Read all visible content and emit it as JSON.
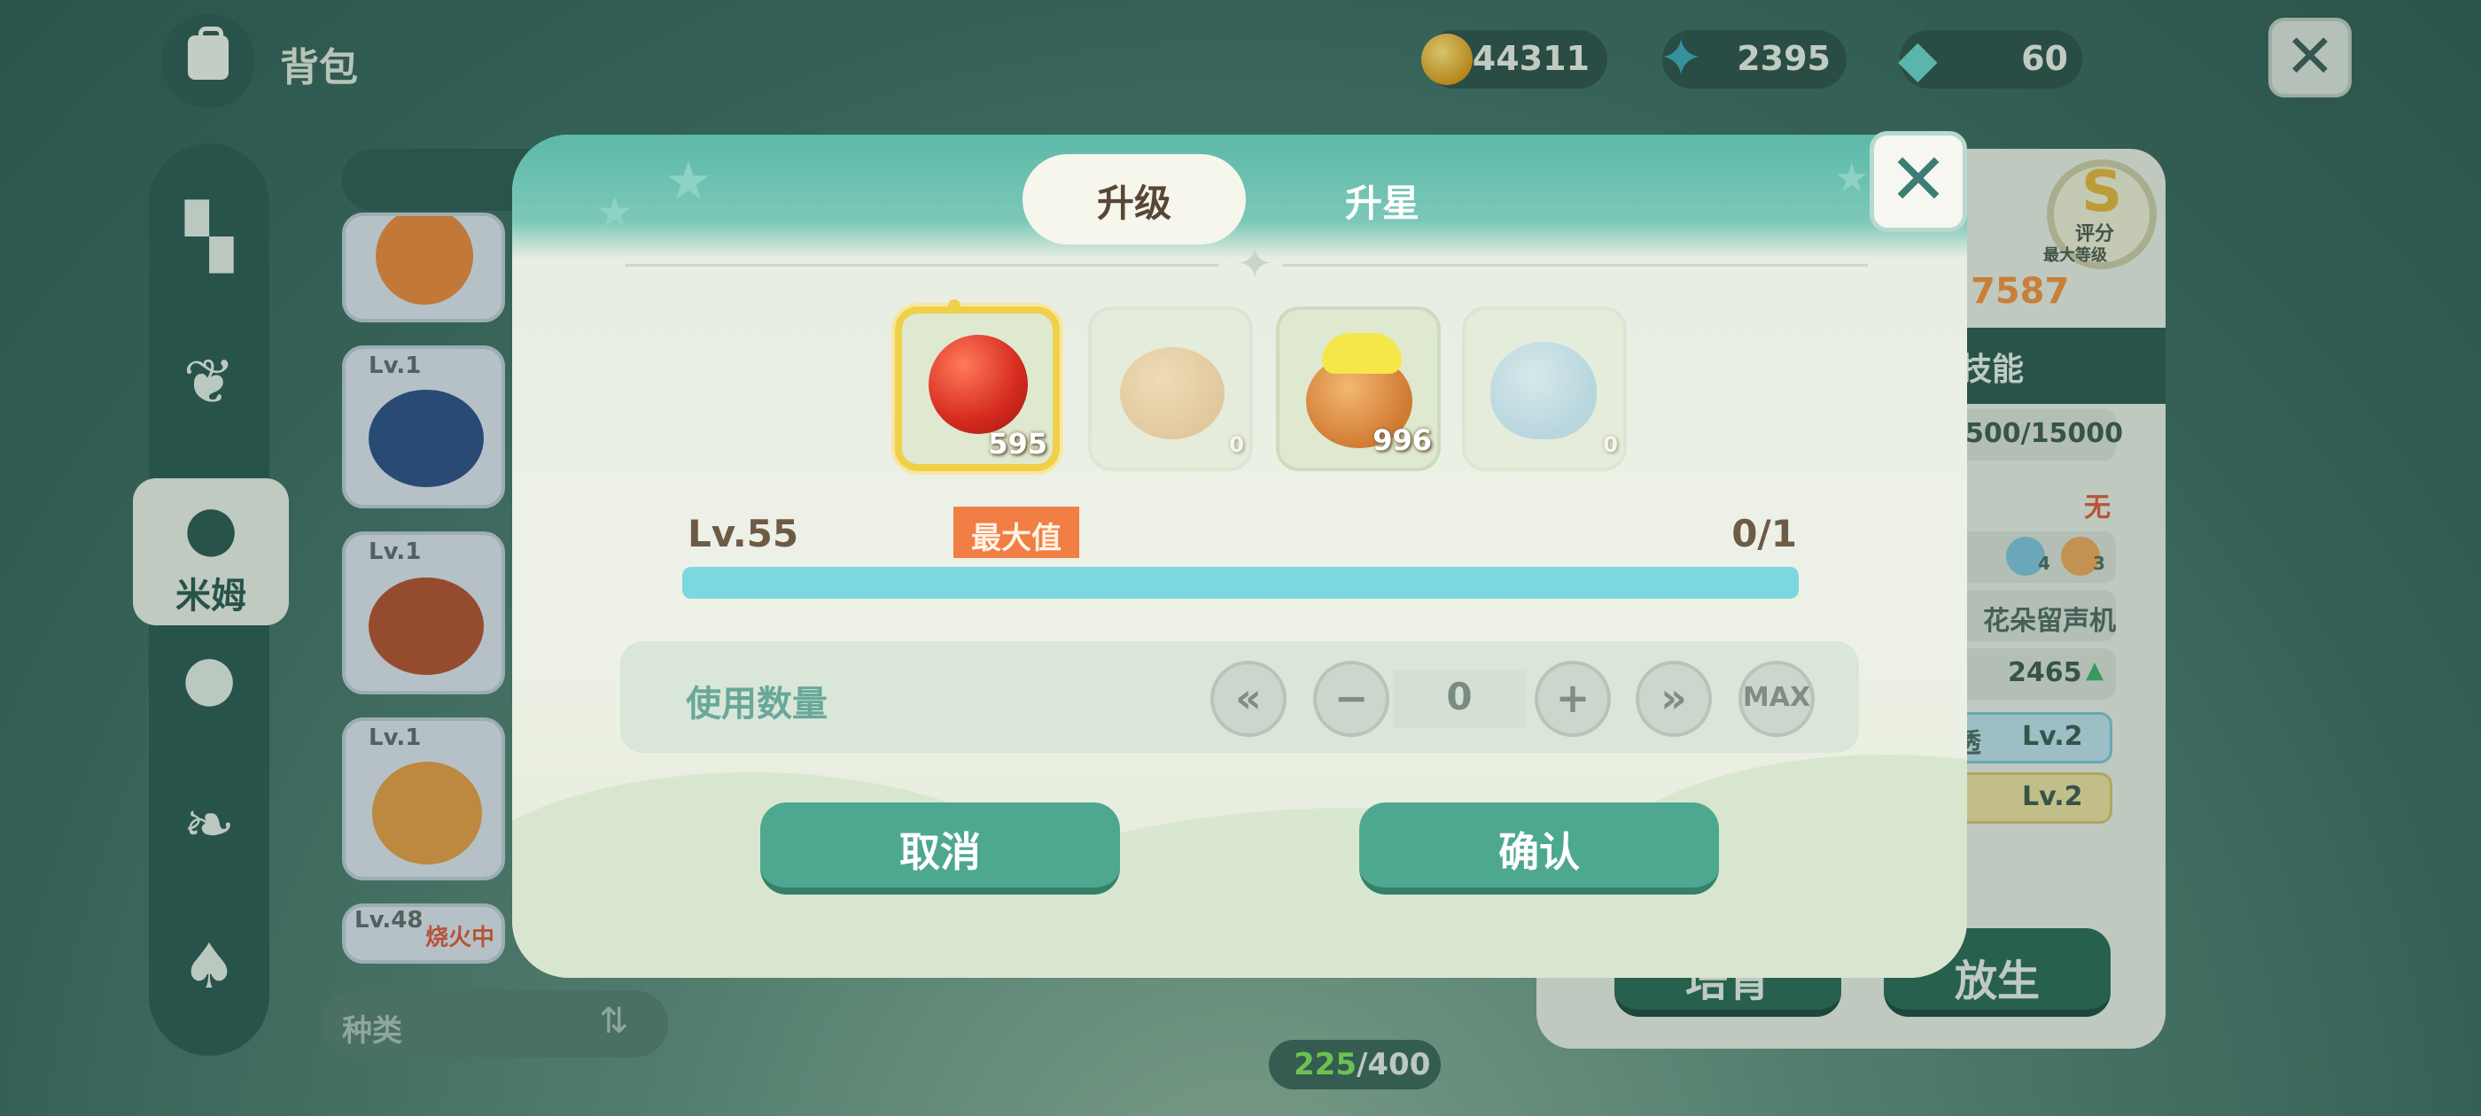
{
  "header": {
    "title": "背包",
    "bag_icon": "backpack-icon"
  },
  "currencies": [
    {
      "icon": "gold-coin-icon",
      "value": "44311"
    },
    {
      "icon": "star-shard-icon",
      "value": "2395"
    },
    {
      "icon": "gem-icon",
      "value": "60"
    }
  ],
  "left_nav": {
    "items": [
      {
        "icon": "grid-icon"
      },
      {
        "icon": "sprout-icon"
      },
      {
        "icon": "mim-icon",
        "label": "米姆",
        "active": true
      },
      {
        "icon": "mim-outline-icon"
      },
      {
        "icon": "leaf-icon"
      },
      {
        "icon": "tree-icon"
      }
    ]
  },
  "monster_list": {
    "cards": [
      {
        "level": ""
      },
      {
        "level": "Lv.1"
      },
      {
        "level": "Lv.1"
      },
      {
        "level": "Lv.1"
      },
      {
        "level": "Lv.48",
        "status": "烧火中"
      }
    ],
    "sort_label": "种类",
    "count_current": "225",
    "count_total": "/400"
  },
  "detail_panel": {
    "grade": "S",
    "grade_label": "评分",
    "grade_sub": "最大等级",
    "power": "7587",
    "section_title": "技能",
    "rows": {
      "exp": "500/15000",
      "none": "无",
      "badge_a": "4",
      "badge_b": "3",
      "item": "花朵留声机",
      "stat": "2465",
      "skill_a_name": "透",
      "skill_a_level": "Lv.2",
      "skill_b_level": "Lv.2"
    },
    "buttons": {
      "left": "培育",
      "right": "放生"
    }
  },
  "modal": {
    "tabs": [
      {
        "label": "升级",
        "active": true
      },
      {
        "label": "升星",
        "active": false
      }
    ],
    "items": [
      {
        "name": "red-fruit",
        "count": "595",
        "selected": true
      },
      {
        "name": "honey-pot",
        "count": "0",
        "selected": false
      },
      {
        "name": "yellow-honey-pot",
        "count": "996",
        "selected": false
      },
      {
        "name": "blue-drop",
        "count": "0",
        "selected": false
      }
    ],
    "level": "Lv.55",
    "max_badge": "最大值",
    "progress_text": "0/1",
    "progress_fraction": 1.0,
    "use_label": "使用数量",
    "quantity": "0",
    "qty_buttons": {
      "min": "«",
      "minus": "−",
      "plus": "+",
      "max_step": "»",
      "max": "MAX"
    },
    "cancel": "取消",
    "confirm": "确认"
  },
  "colors": {
    "accent": "#4ea890",
    "teal_header": "#5cb9a8",
    "max_badge": "#f07e45",
    "progress": "#7cd8e0"
  }
}
